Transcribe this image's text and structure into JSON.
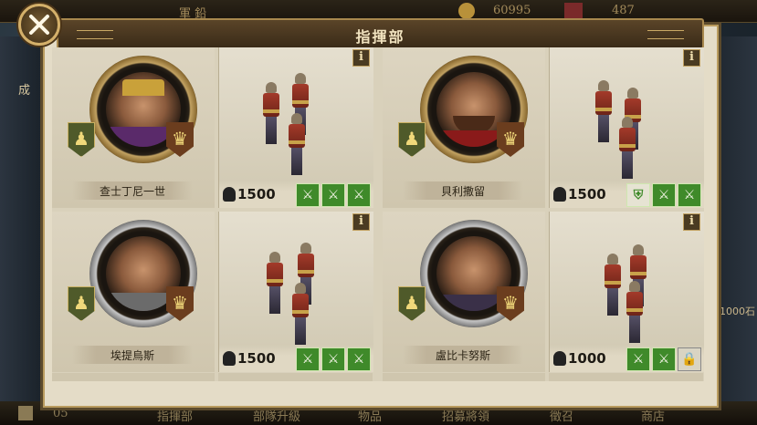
{
  "topbar": {
    "label1": "軍 鉛",
    "coins": "60995",
    "gems": "487"
  },
  "sidebar_left": {
    "label": "成"
  },
  "sidebar_right": {
    "label": "1000石"
  },
  "panel": {
    "title": "指揮部",
    "close_label": "✕",
    "info_label": "i"
  },
  "generals": [
    {
      "name": "查士丁尼一世",
      "troops": 1500,
      "frame": "gold",
      "unit_icons": [
        "sword",
        "sword",
        "sword"
      ]
    },
    {
      "name": "貝利撒留",
      "troops": 1500,
      "frame": "gold",
      "unit_icons": [
        "shield",
        "sword",
        "sword"
      ]
    },
    {
      "name": "埃提烏斯",
      "troops": 1500,
      "frame": "silver",
      "unit_icons": [
        "sword",
        "sword",
        "sword"
      ]
    },
    {
      "name": "盧比卡努斯",
      "troops": 1000,
      "frame": "silver",
      "unit_icons": [
        "sword",
        "sword",
        "lock"
      ]
    }
  ],
  "bottom_nav": {
    "page_num": "05",
    "items": [
      "指揮部",
      "部隊升級",
      "物品",
      "招募將領",
      "徵召",
      "商店"
    ]
  },
  "colors": {
    "panel_bg": "#e4dcc7",
    "frame_gold": "#c2a262",
    "button_green": "#3f8a2a"
  }
}
